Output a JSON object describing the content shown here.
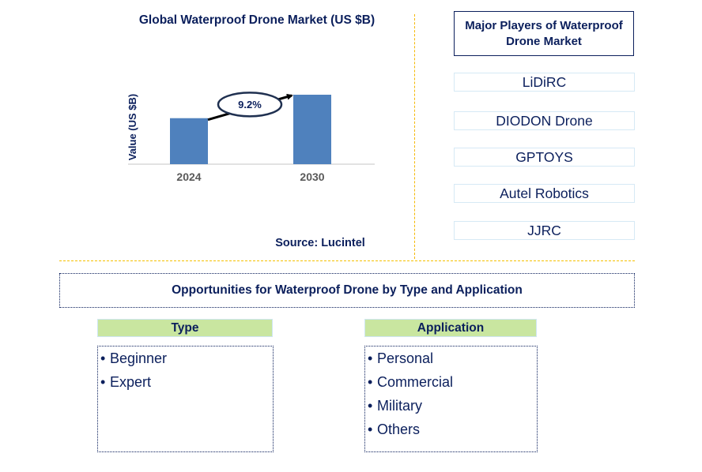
{
  "chart_data": {
    "type": "bar",
    "title": "Global Waterproof Drone Market (US $B)",
    "xlabel": "",
    "ylabel": "Value (US $B)",
    "categories": [
      "2024",
      "2030"
    ],
    "values": [
      1.0,
      1.51
    ],
    "value_note": "Relative heights; no absolute values printed on chart",
    "annotation": {
      "text": "9.2%",
      "meaning": "CAGR 2024-2030",
      "from": "2024",
      "to": "2030"
    },
    "grid": false,
    "bar_color": "#4f81bd",
    "source": "Source: Lucintel"
  },
  "players": {
    "title": "Major Players of Waterproof Drone Market",
    "items": [
      "LiDiRC",
      "DIODON Drone",
      "GPTOYS",
      "Autel Robotics",
      "JJRC"
    ]
  },
  "opportunities": {
    "title": "Opportunities for Waterproof Drone by Type and Application",
    "type": {
      "header": "Type",
      "items": [
        "Beginner",
        "Expert"
      ]
    },
    "application": {
      "header": "Application",
      "items": [
        "Personal",
        "Commercial",
        "Military",
        "Others"
      ]
    }
  },
  "colors": {
    "text": "#0b1f5c",
    "bar": "#4f81bd",
    "divider": "#f5b800",
    "category_header": "#c9e6a0",
    "player_border": "#d6e9f5"
  }
}
